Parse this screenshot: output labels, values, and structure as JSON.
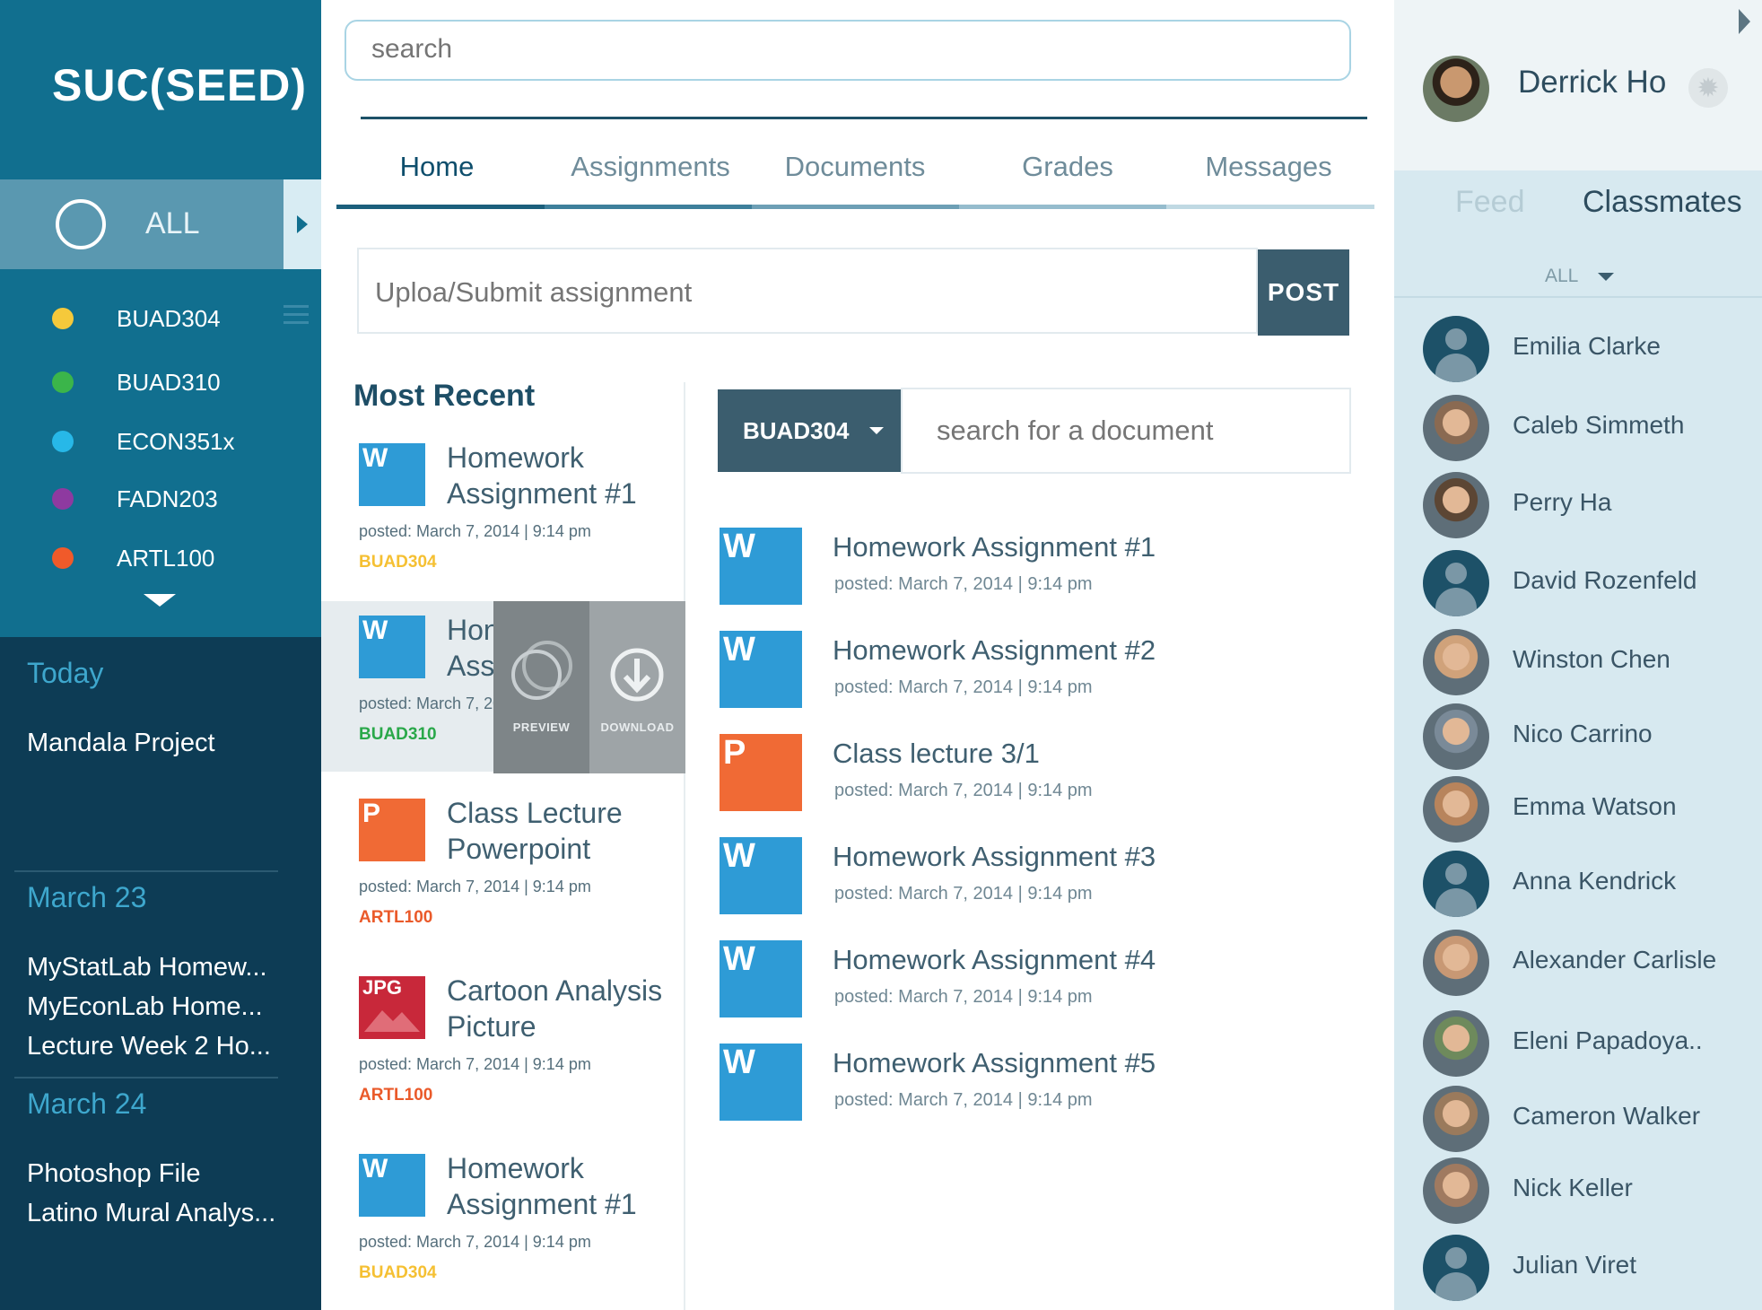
{
  "app": {
    "logo": "SUC(SEED)"
  },
  "colors": {
    "sidebar": "#116f8f",
    "schedule_bg": "#0d3c55",
    "accent": "#3b5d6e",
    "word_blue": "#2e9bd6",
    "ppt_orange": "#f06a35",
    "jpg_red": "#c8283a",
    "course_yellow": "#f5c033",
    "course_green": "#2aa84a",
    "course_orange": "#ea5a2a"
  },
  "sidebar": {
    "all_label": "ALL",
    "courses": [
      {
        "label": "BUAD304",
        "color": "#f5c93b"
      },
      {
        "label": "BUAD310",
        "color": "#3bb54a"
      },
      {
        "label": "ECON351x",
        "color": "#27b8e8"
      },
      {
        "label": "FADN203",
        "color": "#8e3aa0"
      },
      {
        "label": "ARTL100",
        "color": "#f05a2a"
      }
    ],
    "schedule": [
      {
        "heading": "Today",
        "items": [
          "Mandala Project"
        ]
      },
      {
        "heading": "March 23",
        "items": [
          "MyStatLab Homew...",
          "MyEconLab Home...",
          "Lecture Week 2 Ho..."
        ]
      },
      {
        "heading": "March 24",
        "items": [
          "Photoshop File",
          "Latino Mural Analys..."
        ]
      }
    ]
  },
  "search": {
    "placeholder": "search"
  },
  "tabs": [
    {
      "label": "Home",
      "active": true
    },
    {
      "label": "Assignments",
      "active": false
    },
    {
      "label": "Documents",
      "active": false
    },
    {
      "label": "Grades",
      "active": false
    },
    {
      "label": "Messages",
      "active": false
    }
  ],
  "upload": {
    "placeholder": "Uploa/Submit assignment",
    "post_label": "POST"
  },
  "recent": {
    "title": "Most Recent",
    "items": [
      {
        "type": "W",
        "title_line1": "Homework",
        "title_line2": "Assignment #1",
        "posted": "posted: March 7, 2014 | 9:14 pm",
        "course": "BUAD304",
        "course_color": "#f5c033"
      },
      {
        "type": "W",
        "title_line1": "Hon",
        "title_line2": "Assi",
        "posted": "posted: March 7, 201",
        "course": "BUAD310",
        "course_color": "#2aa84a"
      },
      {
        "type": "P",
        "title_line1": "Class Lecture",
        "title_line2": "Powerpoint",
        "posted": "posted: March 7, 2014 | 9:14 pm",
        "course": "ARTL100",
        "course_color": "#ea5a2a"
      },
      {
        "type": "JPG",
        "title_line1": "Cartoon Analysis",
        "title_line2": "Picture",
        "posted": "posted: March 7, 2014 | 9:14 pm",
        "course": "ARTL100",
        "course_color": "#ea5a2a"
      },
      {
        "type": "W",
        "title_line1": "Homework",
        "title_line2": "Assignment #1",
        "posted": "posted: March 7, 2014 | 9:14 pm",
        "course": "BUAD304",
        "course_color": "#f5c033"
      }
    ],
    "hover_actions": {
      "preview_label": "PREVIEW",
      "download_label": "DOWNLOAD"
    }
  },
  "documents": {
    "filter_label": "BUAD304",
    "search_placeholder": "search for a document",
    "items": [
      {
        "type": "W",
        "title": "Homework Assignment #1",
        "posted": "posted: March 7, 2014 | 9:14 pm"
      },
      {
        "type": "W",
        "title": "Homework Assignment #2",
        "posted": "posted: March 7, 2014 | 9:14 pm"
      },
      {
        "type": "P",
        "title": "Class lecture 3/1",
        "posted": "posted: March 7, 2014 | 9:14 pm"
      },
      {
        "type": "W",
        "title": "Homework Assignment #3",
        "posted": "posted: March 7, 2014 | 9:14 pm"
      },
      {
        "type": "W",
        "title": "Homework Assignment #4",
        "posted": "posted: March 7, 2014 | 9:14 pm"
      },
      {
        "type": "W",
        "title": "Homework Assignment #5",
        "posted": "posted: March 7, 2014 | 9:14 pm"
      }
    ]
  },
  "profile": {
    "name": "Derrick Ho"
  },
  "right_panel": {
    "feed_tab": "Feed",
    "classmates_tab": "Classmates",
    "filter_label": "ALL",
    "classmates": [
      {
        "name": "Emilia Clarke",
        "photo": false
      },
      {
        "name": "Caleb Simmeth",
        "photo": true
      },
      {
        "name": "Perry Ha",
        "photo": true
      },
      {
        "name": "David Rozenfeld",
        "photo": false
      },
      {
        "name": "Winston Chen",
        "photo": true
      },
      {
        "name": "Nico Carrino",
        "photo": true
      },
      {
        "name": "Emma Watson",
        "photo": true
      },
      {
        "name": "Anna Kendrick",
        "photo": false
      },
      {
        "name": "Alexander Carlisle",
        "photo": true
      },
      {
        "name": "Eleni Papadoya..",
        "photo": true
      },
      {
        "name": "Cameron Walker",
        "photo": true
      },
      {
        "name": "Nick Keller",
        "photo": true
      },
      {
        "name": "Julian Viret",
        "photo": false
      }
    ]
  }
}
